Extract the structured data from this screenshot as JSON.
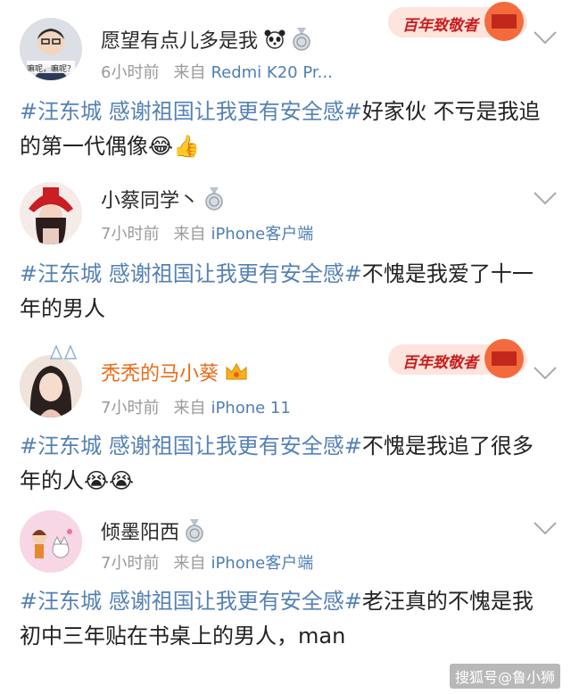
{
  "posts": [
    {
      "username": "愿望有点儿多是我",
      "time": "6小时前",
      "from_label": "来自",
      "source": "Redmi K20 Pr...",
      "hashtag": "#汪东城 感谢祖国让我更有安全感#",
      "body": "好家伙  不亏是我追的第一代偶像",
      "emoji": "😂👍",
      "avatar_caption": "嘛呢，嘛呢？",
      "banner_text": "百年致敬者"
    },
    {
      "username": "小蔡同学丶",
      "time": "7小时前",
      "from_label": "来自",
      "source": "iPhone客户端",
      "hashtag": "#汪东城 感谢祖国让我更有安全感#",
      "body": "不愧是我爱了十一年的男人"
    },
    {
      "username": "秃秃的马小葵",
      "time": "7小时前",
      "from_label": "来自",
      "source": "iPhone 11",
      "hashtag": "#汪东城 感谢祖国让我更有安全感#",
      "body": "不愧是我追了很多年的人",
      "emoji": "😭😭",
      "banner_text": "百年致敬者"
    },
    {
      "username": "倾墨阳西",
      "time": "7小时前",
      "from_label": "来自",
      "source": "iPhone客户端",
      "hashtag": "#汪东城 感谢祖国让我更有安全感#",
      "body": "老汪真的不愧是我初中三年贴在书桌上的男人，man"
    }
  ],
  "watermark": "搜狐号@鲁小狮",
  "colors": {
    "link": "#5581b4",
    "vip_name": "#ea6b18",
    "meta": "#9a9a9a"
  },
  "icons": [
    "panda-icon",
    "medal-icon",
    "crown-icon",
    "chevron-down-icon"
  ]
}
